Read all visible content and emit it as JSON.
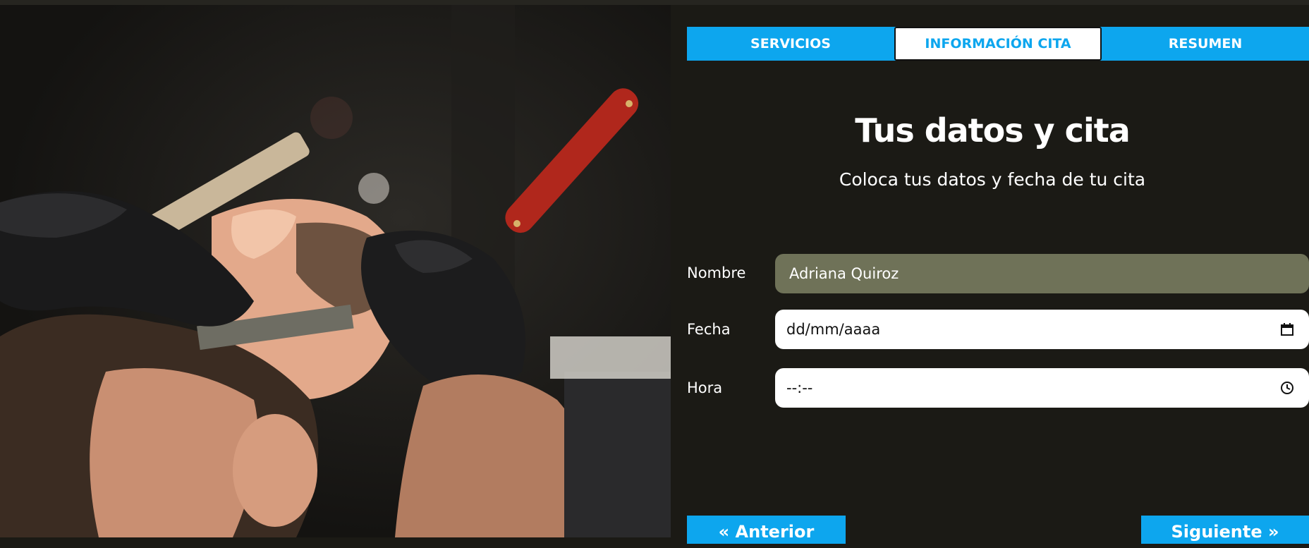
{
  "hero": {
    "alt": "Barbero afeitando con navaja a un cliente",
    "icon": "barber-photo"
  },
  "tabs": [
    {
      "label": "SERVICIOS",
      "active": false
    },
    {
      "label": "INFORMACIÓN CITA",
      "active": true
    },
    {
      "label": "RESUMEN",
      "active": false
    }
  ],
  "main": {
    "title": "Tus datos y cita",
    "subtitle": "Coloca tus datos y fecha de tu cita"
  },
  "form": {
    "name": {
      "label": "Nombre",
      "value": "Adriana Quiroz"
    },
    "date": {
      "label": "Fecha",
      "placeholder": "dd/mm/aaaa",
      "icon": "calendar-icon"
    },
    "time": {
      "label": "Hora",
      "placeholder": "--:--",
      "icon": "clock-icon"
    }
  },
  "nav": {
    "prev_label": "« Anterior",
    "next_label": "Siguiente »"
  },
  "colors": {
    "accent": "#0da6ee",
    "background": "#1b1a15",
    "name_field": "#6f7258"
  }
}
